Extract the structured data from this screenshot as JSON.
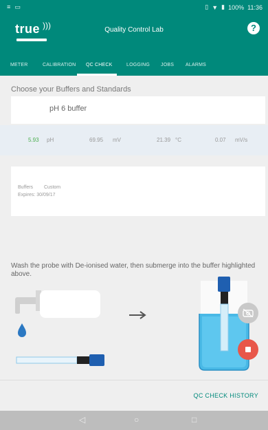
{
  "status_bar": {
    "battery": "100%",
    "time": "11:36"
  },
  "app_bar": {
    "logo_text": "true",
    "title": "Quality Control Lab",
    "help_icon": "help-icon"
  },
  "tabs": [
    {
      "label": "METER"
    },
    {
      "label": "CALIBRATION"
    },
    {
      "label": "QC CHECK"
    },
    {
      "label": "LOGGING"
    },
    {
      "label": "JOBS"
    },
    {
      "label": "ALARMS"
    }
  ],
  "active_tab": "QC CHECK",
  "section_heading": "Choose your Buffers and Standards",
  "buffer": {
    "name": "pH 6 buffer"
  },
  "readings": [
    {
      "value": "5.93",
      "unit": "pH"
    },
    {
      "value": "69.95",
      "unit": "mV"
    },
    {
      "value": "21.39",
      "unit": "°C"
    },
    {
      "value": "0.07",
      "unit": "mV/s"
    }
  ],
  "info": {
    "buffers_label": "Buffers",
    "buffers_value": "Custom",
    "expires": "Expires: 30/09/17"
  },
  "instructions": "Wash the probe with De-ionised water, then submerge into the buffer highlighted above.",
  "history_button": "QC CHECK HISTORY",
  "colors": {
    "primary": "#00897b",
    "record": "#e8574a",
    "reading_ph": "#4caf50"
  }
}
